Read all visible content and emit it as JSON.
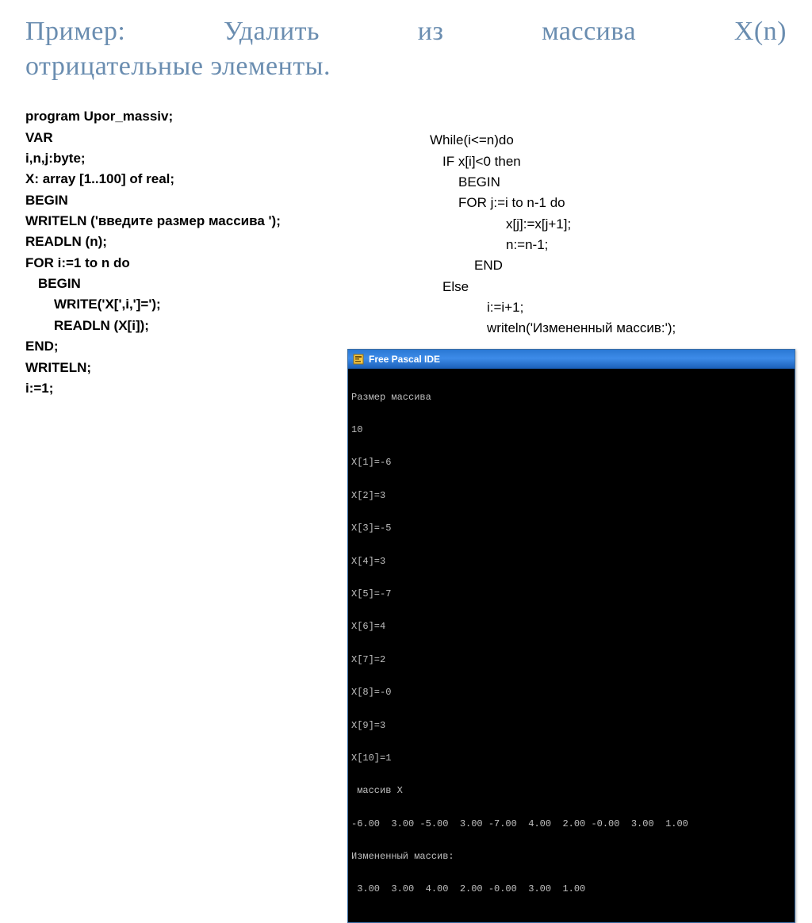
{
  "title_line1": "Пример:   Удалить   из   массива   X(n)",
  "title_line2": "отрицательные элементы.",
  "left_code": {
    "l1": "program Upor_massiv;",
    "l2": "VAR",
    "l3": "i,n,j:byte;",
    "l4": "X: array [1..100] of real;",
    "l5": "BEGIN",
    "l6": "WRITELN ('введите размер массива ');",
    "l7": "READLN (n);",
    "l8": "FOR i:=1 to n do",
    "l9": "BEGIN",
    "l10": "WRITE('X[',i,']=');",
    "l11": "READLN (X[i]);",
    "l12": "END;",
    "l13": "WRITELN;",
    "l14": "i:=1;"
  },
  "right_code": {
    "l1": "While(i<=n)do",
    "l2": "IF x[i]<0 then",
    "l3": "BEGIN",
    "l4": "FOR j:=i to n-1 do",
    "l5": "x[j]:=x[j+1];",
    "l6": "n:=n-1;",
    "l7": "END",
    "l8": "Else",
    "l9": "i:=i+1;",
    "l10": "writeln('Измененный массив:');"
  },
  "console": {
    "title": "Free Pascal IDE",
    "lines": [
      "Размер массива",
      "10",
      "X[1]=-6",
      "X[2]=3",
      "X[3]=-5",
      "X[4]=3",
      "X[5]=-7",
      "X[6]=4",
      "X[7]=2",
      "X[8]=-0",
      "X[9]=3",
      "X[10]=1",
      " массив X",
      "-6.00  3.00 -5.00  3.00 -7.00  4.00  2.00 -0.00  3.00  1.00",
      "Измененный массив:",
      " 3.00  3.00  4.00  2.00 -0.00  3.00  1.00"
    ]
  }
}
